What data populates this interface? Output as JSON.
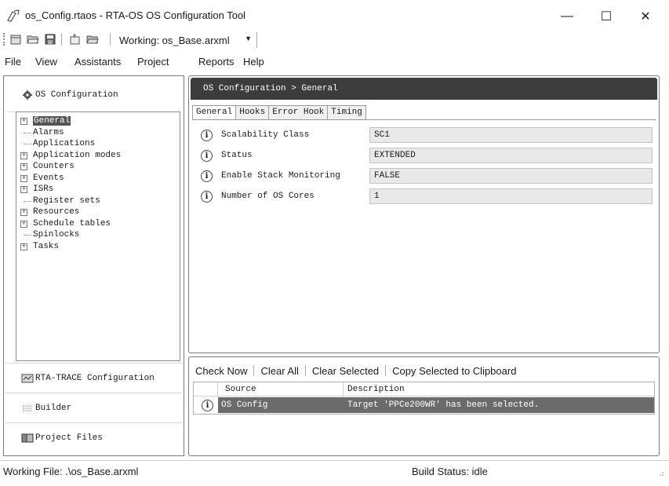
{
  "window": {
    "title": "os_Config.rtaos - RTA-OS OS Configuration Tool",
    "min_glyph": "—",
    "max_glyph": "☐",
    "close_glyph": "✕"
  },
  "toolbar": {
    "working_label": "Working: os_Base.arxml"
  },
  "menu": [
    "File",
    "View",
    "Assistants",
    "Project",
    "Reports",
    "Help"
  ],
  "left_pane": {
    "header": "OS Configuration",
    "tree": [
      {
        "label": "General",
        "expandable": true,
        "selected": true
      },
      {
        "label": "Alarms",
        "expandable": false
      },
      {
        "label": "Applications",
        "expandable": false
      },
      {
        "label": "Application modes",
        "expandable": true
      },
      {
        "label": "Counters",
        "expandable": true
      },
      {
        "label": "Events",
        "expandable": true
      },
      {
        "label": "ISRs",
        "expandable": true
      },
      {
        "label": "Register sets",
        "expandable": false
      },
      {
        "label": "Resources",
        "expandable": true
      },
      {
        "label": "Schedule tables",
        "expandable": true
      },
      {
        "label": "Spinlocks",
        "expandable": false
      },
      {
        "label": "Tasks",
        "expandable": true
      }
    ],
    "nav": {
      "trace": "RTA-TRACE Configuration",
      "builder": "Builder",
      "project": "Project Files"
    }
  },
  "main": {
    "breadcrumb": "OS Configuration > General",
    "tabs": [
      "General",
      "Hooks",
      "Error Hook",
      "Timing"
    ],
    "properties": [
      {
        "name": "Scalability Class",
        "value": "SC1"
      },
      {
        "name": "Status",
        "value": "EXTENDED"
      },
      {
        "name": "Enable Stack Monitoring",
        "value": "FALSE"
      },
      {
        "name": "Number of OS Cores",
        "value": "1"
      }
    ]
  },
  "messages": {
    "actions": [
      "Check Now",
      "Clear All",
      "Clear Selected",
      "Copy Selected to Clipboard"
    ],
    "columns": {
      "source": "Source",
      "description": "Description"
    },
    "rows": [
      {
        "source": "OS Config",
        "description": "Target 'PPCe200WR' has been selected."
      }
    ]
  },
  "status": {
    "working_file": "Working File: .\\os_Base.arxml",
    "build": "Build Status: idle"
  },
  "icons": {
    "app": "gear-pen-icon",
    "info": "info-circle-icon"
  },
  "colors": {
    "header_dark": "#3c3c3c",
    "selection": "#6b6b6b"
  }
}
